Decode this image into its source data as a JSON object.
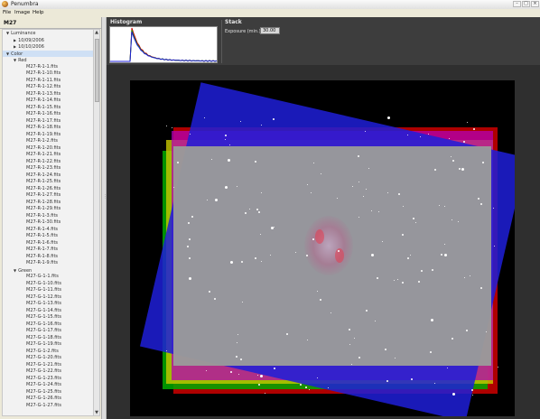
{
  "window": {
    "title": "Penumbra"
  },
  "menu": [
    "File",
    "Image",
    "Help"
  ],
  "left_panel": {
    "header": "M27",
    "tree": [
      {
        "label": "Luminance",
        "depth": 0,
        "expander": "▼"
      },
      {
        "label": "10/09/2006",
        "depth": 1,
        "expander": "▶"
      },
      {
        "label": "10/10/2006",
        "depth": 1,
        "expander": "▶"
      },
      {
        "label": "Color",
        "depth": 0,
        "expander": "▼",
        "selected": true
      },
      {
        "label": "Red",
        "depth": 1,
        "expander": "▼"
      },
      {
        "label": "M27-R-1-1.fits",
        "depth": 2
      },
      {
        "label": "M27-R-1-10.fits",
        "depth": 2
      },
      {
        "label": "M27-R-1-11.fits",
        "depth": 2
      },
      {
        "label": "M27-R-1-12.fits",
        "depth": 2
      },
      {
        "label": "M27-R-1-13.fits",
        "depth": 2
      },
      {
        "label": "M27-R-1-14.fits",
        "depth": 2
      },
      {
        "label": "M27-R-1-15.fits",
        "depth": 2
      },
      {
        "label": "M27-R-1-16.fits",
        "depth": 2
      },
      {
        "label": "M27-R-1-17.fits",
        "depth": 2
      },
      {
        "label": "M27-R-1-18.fits",
        "depth": 2
      },
      {
        "label": "M27-R-1-19.fits",
        "depth": 2
      },
      {
        "label": "M27-R-1-2.fits",
        "depth": 2
      },
      {
        "label": "M27-R-1-20.fits",
        "depth": 2
      },
      {
        "label": "M27-R-1-21.fits",
        "depth": 2
      },
      {
        "label": "M27-R-1-22.fits",
        "depth": 2
      },
      {
        "label": "M27-R-1-23.fits",
        "depth": 2
      },
      {
        "label": "M27-R-1-24.fits",
        "depth": 2
      },
      {
        "label": "M27-R-1-25.fits",
        "depth": 2
      },
      {
        "label": "M27-R-1-26.fits",
        "depth": 2
      },
      {
        "label": "M27-R-1-27.fits",
        "depth": 2
      },
      {
        "label": "M27-R-1-28.fits",
        "depth": 2
      },
      {
        "label": "M27-R-1-29.fits",
        "depth": 2
      },
      {
        "label": "M27-R-1-3.fits",
        "depth": 2
      },
      {
        "label": "M27-R-1-30.fits",
        "depth": 2
      },
      {
        "label": "M27-R-1-4.fits",
        "depth": 2
      },
      {
        "label": "M27-R-1-5.fits",
        "depth": 2
      },
      {
        "label": "M27-R-1-6.fits",
        "depth": 2
      },
      {
        "label": "M27-R-1-7.fits",
        "depth": 2
      },
      {
        "label": "M27-R-1-8.fits",
        "depth": 2
      },
      {
        "label": "M27-R-1-9.fits",
        "depth": 2
      },
      {
        "label": "Green",
        "depth": 1,
        "expander": "▼"
      },
      {
        "label": "M27-G-1-1.fits",
        "depth": 2
      },
      {
        "label": "M27-G-1-10.fits",
        "depth": 2
      },
      {
        "label": "M27-G-1-11.fits",
        "depth": 2
      },
      {
        "label": "M27-G-1-12.fits",
        "depth": 2
      },
      {
        "label": "M27-G-1-13.fits",
        "depth": 2
      },
      {
        "label": "M27-G-1-14.fits",
        "depth": 2
      },
      {
        "label": "M27-G-1-15.fits",
        "depth": 2
      },
      {
        "label": "M27-G-1-16.fits",
        "depth": 2
      },
      {
        "label": "M27-G-1-17.fits",
        "depth": 2
      },
      {
        "label": "M27-G-1-18.fits",
        "depth": 2
      },
      {
        "label": "M27-G-1-19.fits",
        "depth": 2
      },
      {
        "label": "M27-G-1-2.fits",
        "depth": 2
      },
      {
        "label": "M27-G-1-20.fits",
        "depth": 2
      },
      {
        "label": "M27-G-1-21.fits",
        "depth": 2
      },
      {
        "label": "M27-G-1-22.fits",
        "depth": 2
      },
      {
        "label": "M27-G-1-23.fits",
        "depth": 2
      },
      {
        "label": "M27-G-1-24.fits",
        "depth": 2
      },
      {
        "label": "M27-G-1-25.fits",
        "depth": 2
      },
      {
        "label": "M27-G-1-26.fits",
        "depth": 2
      },
      {
        "label": "M27-G-1-27.fits",
        "depth": 2
      }
    ]
  },
  "histogram": {
    "title": "Histogram"
  },
  "stack": {
    "title": "Stack",
    "exposure_label": "Exposure (min.):",
    "exposure_value": "30.00"
  },
  "colors": {
    "red": "#cc0000",
    "green": "#00aa00",
    "blue": "#1f1fd8",
    "yellow": "#c8c800",
    "magenta": "#b400b4",
    "gray": "#9a9a9a"
  }
}
